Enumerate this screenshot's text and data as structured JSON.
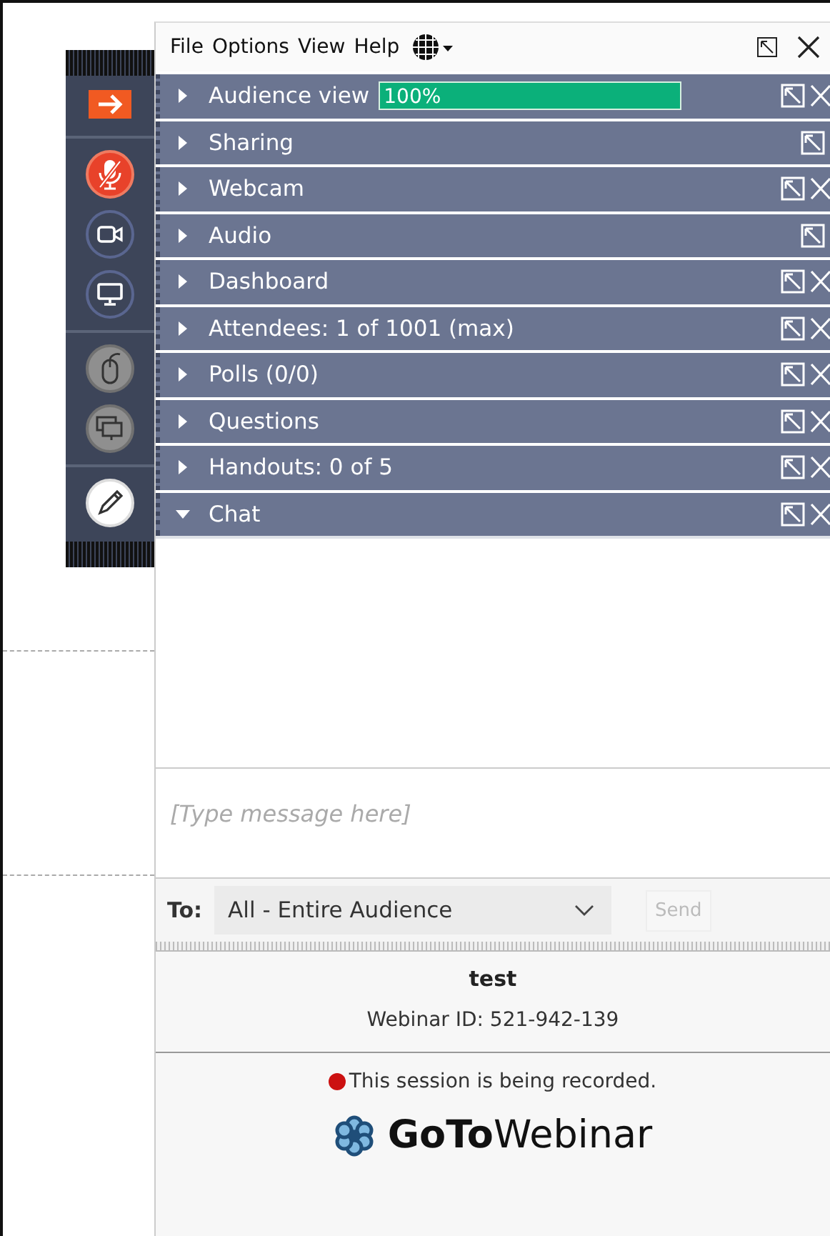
{
  "menu": {
    "items": [
      "File",
      "Options",
      "View",
      "Help"
    ]
  },
  "toolbar": [
    {
      "kind": "collapse",
      "disabled": false
    },
    {
      "kind": "microphone",
      "disabled": false
    },
    {
      "kind": "webcam",
      "disabled": false
    },
    {
      "kind": "screen",
      "disabled": false
    },
    {
      "kind": "mouse",
      "disabled": true
    },
    {
      "kind": "screens",
      "disabled": true
    },
    {
      "kind": "pen",
      "disabled": false
    }
  ],
  "panels": [
    {
      "title": "Audience view",
      "expanded": false,
      "closable": true,
      "meter": {
        "reading": "100%",
        "level": 1
      }
    },
    {
      "title": "Sharing",
      "expanded": false,
      "closable": false
    },
    {
      "title": "Webcam",
      "expanded": false,
      "closable": true
    },
    {
      "title": "Audio",
      "expanded": false,
      "closable": false
    },
    {
      "title": "Dashboard",
      "expanded": false,
      "closable": true
    },
    {
      "title": "Attendees:  1 of 1001 (max)",
      "expanded": false,
      "closable": true
    },
    {
      "title": "Polls (0/0)",
      "expanded": false,
      "closable": true
    },
    {
      "title": "Questions",
      "expanded": false,
      "closable": true
    },
    {
      "title": "Handouts: 0 of 5",
      "expanded": false,
      "closable": true
    },
    {
      "title": "Chat",
      "expanded": true,
      "closable": true
    }
  ],
  "chat": {
    "placeholder": "[Type message here]",
    "to_label": "To:",
    "recipient": "All - Entire Audience",
    "send": "Send"
  },
  "footer": {
    "title": "test",
    "webinar_id": "Webinar ID: 521-942-139",
    "recording": "This session is being recorded.",
    "logo": "**GoTo**Webinar"
  }
}
